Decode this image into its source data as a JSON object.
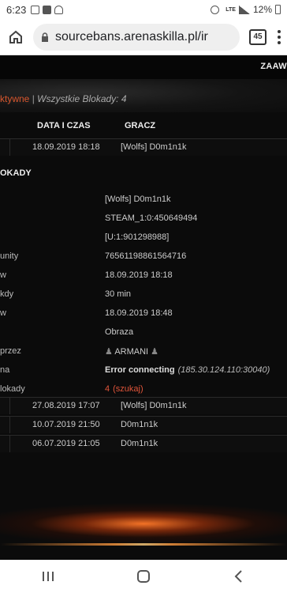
{
  "status_bar": {
    "time": "6:23",
    "battery": "12%",
    "network": "LTE"
  },
  "browser": {
    "url": "sourcebans.arenaskilla.pl/ir",
    "tab_count": "45"
  },
  "site": {
    "nav_partial": "ZAAW"
  },
  "counts": {
    "active": "ktywne",
    "separator": " | ",
    "all": "Wszystkie Blokady: 4"
  },
  "table": {
    "headers": [
      "DATA I CZAS",
      "GRACZ"
    ],
    "first_row": {
      "date": "18.09.2019 18:18",
      "player": "[Wolfs] D0m1n1k"
    }
  },
  "details": {
    "title": "OKADY",
    "rows": [
      {
        "label": "",
        "value": "[Wolfs] D0m1n1k",
        "style": "plain"
      },
      {
        "label": "",
        "value": "STEAM_1:0:450649494",
        "style": "plain"
      },
      {
        "label": "",
        "value": "[U:1:901298988]",
        "style": "red"
      },
      {
        "label": "unity",
        "value": "76561198861564716",
        "style": "red"
      },
      {
        "label": "w",
        "value": "18.09.2019 18:18",
        "style": "plain"
      },
      {
        "label": "kdy",
        "value": "30 min",
        "style": "plain"
      },
      {
        "label": "w",
        "value": "18.09.2019 18:48",
        "style": "plain"
      },
      {
        "label": "",
        "value": "Obraza",
        "style": "plain"
      },
      {
        "label": "przez",
        "value": "ARMANI",
        "style": "admin"
      },
      {
        "label": "na",
        "value": "Error connecting",
        "extra": "(185.30.124.110:30040)",
        "style": "error"
      },
      {
        "label": "lokady",
        "value": "4",
        "extra": "(szukaj)",
        "style": "count"
      }
    ]
  },
  "history": [
    {
      "date": "27.08.2019 17:07",
      "player": "[Wolfs] D0m1n1k"
    },
    {
      "date": "10.07.2019 21:50",
      "player": "D0m1n1k"
    },
    {
      "date": "06.07.2019 21:05",
      "player": "D0m1n1k"
    }
  ],
  "colors": {
    "accent": "#e0553a",
    "background": "#0b0b0b"
  }
}
